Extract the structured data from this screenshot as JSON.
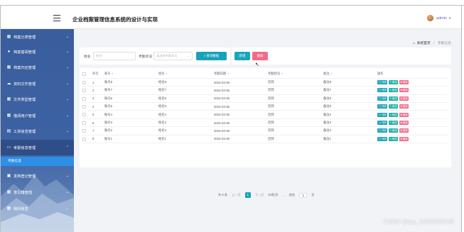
{
  "header": {
    "title": "企业档案管理信息系统的设计与实现",
    "user": "admin"
  },
  "sidebar": {
    "items": [
      {
        "label": "档案分类管理",
        "icon": "grid-icon"
      },
      {
        "label": "档案借阅管理",
        "icon": "user-icon"
      },
      {
        "label": "档案归还管理",
        "icon": "grid-icon"
      },
      {
        "label": "资料文件管理",
        "icon": "cloud-icon"
      },
      {
        "label": "文件类型管理",
        "icon": "grid-icon"
      },
      {
        "label": "借阅用户管理",
        "icon": "grid-icon"
      },
      {
        "label": "工资信息管理",
        "icon": "document-icon"
      },
      {
        "label": "考勤信息管理",
        "icon": "monitor-icon"
      },
      {
        "label": "发档登记管理",
        "icon": "calendar-icon"
      },
      {
        "label": "意见箱管理",
        "icon": "grid-icon"
      },
      {
        "label": "我的信息",
        "icon": "grid-icon"
      }
    ],
    "active_sub": "考勤信息"
  },
  "breadcrumb": {
    "home": "系统首页",
    "current": "考勤信息"
  },
  "search": {
    "name_label": "姓名",
    "name_placeholder": "姓名",
    "status_label": "考勤状况",
    "status_placeholder": "请选择考勤状况",
    "query_button": "查询数据"
  },
  "actions": {
    "add": "新增",
    "delete": "删除"
  },
  "table": {
    "columns": [
      "序号",
      "账号",
      "姓名",
      "考勤日期",
      "考勤状况",
      "备注",
      "操作"
    ],
    "rows": [
      {
        "index": "1",
        "account": "账号8",
        "name": "姓名8",
        "date": "2024-03-06",
        "status": "迟到",
        "note": "备注8"
      },
      {
        "index": "2",
        "account": "账号7",
        "name": "姓名7",
        "date": "2024-03-06",
        "status": "迟到",
        "note": "备注7"
      },
      {
        "index": "3",
        "account": "账号6",
        "name": "姓名6",
        "date": "2024-03-06",
        "status": "迟到",
        "note": "备注6"
      },
      {
        "index": "4",
        "account": "账号5",
        "name": "姓名5",
        "date": "2024-03-06",
        "status": "迟到",
        "note": "备注5"
      },
      {
        "index": "5",
        "account": "账号4",
        "name": "姓名4",
        "date": "2024-03-06",
        "status": "迟到",
        "note": "备注4"
      },
      {
        "index": "6",
        "account": "账号3",
        "name": "姓名3",
        "date": "2024-03-06",
        "status": "迟到",
        "note": "备注3"
      },
      {
        "index": "7",
        "account": "账号2",
        "name": "姓名2",
        "date": "2024-03-06",
        "status": "迟到",
        "note": "备注2"
      },
      {
        "index": "8",
        "account": "账号1",
        "name": "姓名1",
        "date": "2024-03-06",
        "status": "迟到",
        "note": "备注1"
      }
    ],
    "op_detail": "详情",
    "op_edit": "修改",
    "op_delete": "删除"
  },
  "pager": {
    "total": "共 8 条",
    "prev": "上一页",
    "current_page": "1",
    "next": "下一页",
    "page_size": "10条/页",
    "goto_prefix": "前往",
    "goto_value": "1",
    "goto_suffix": "页"
  },
  "watermark": "CSDN @qq_2083558048",
  "colors": {
    "sidebar": "#3d62a3",
    "accent": "#19a6b9",
    "danger": "#f46a8a",
    "active_sub": "#2d8fe6"
  }
}
